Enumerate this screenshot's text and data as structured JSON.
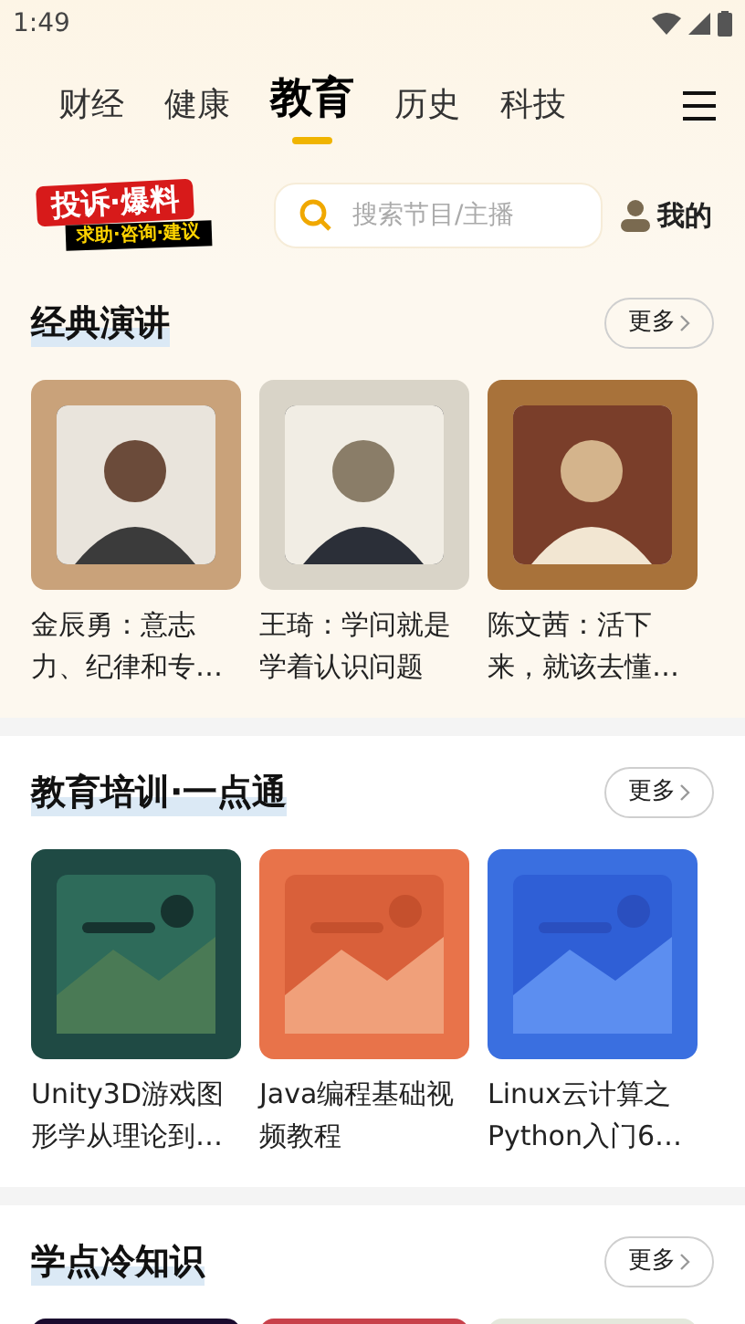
{
  "status_bar": {
    "time": "1:49"
  },
  "tabs": [
    {
      "label": "财经",
      "selected": false
    },
    {
      "label": "健康",
      "selected": false
    },
    {
      "label": "教育",
      "selected": true
    },
    {
      "label": "历史",
      "selected": false
    },
    {
      "label": "科技",
      "selected": false
    }
  ],
  "banner": {
    "title": "投诉·爆料",
    "subtitle": "求助·咨询·建议"
  },
  "search": {
    "placeholder": "搜索节目/主播"
  },
  "profile": {
    "label": "我的"
  },
  "sections": [
    {
      "title": "经典演讲",
      "more": "更多",
      "items": [
        {
          "kind": "picture",
          "title": "金辰勇：意志力、纪律和专…"
        },
        {
          "kind": "picture",
          "title": "王琦：学问就是学着认识问题"
        },
        {
          "kind": "picture",
          "title": "陈文茜：活下来，就该去懂…"
        }
      ]
    },
    {
      "title": "教育培训·一点通",
      "more": "更多",
      "items": [
        {
          "kind": "picture",
          "title": "Unity3D游戏图形学从理论到…"
        },
        {
          "kind": "picture",
          "title": "Java编程基础视频教程"
        },
        {
          "kind": "picture",
          "title": "Linux云计算之Python入门6…"
        }
      ]
    },
    {
      "title": "学点冷知识",
      "more": "更多"
    }
  ]
}
